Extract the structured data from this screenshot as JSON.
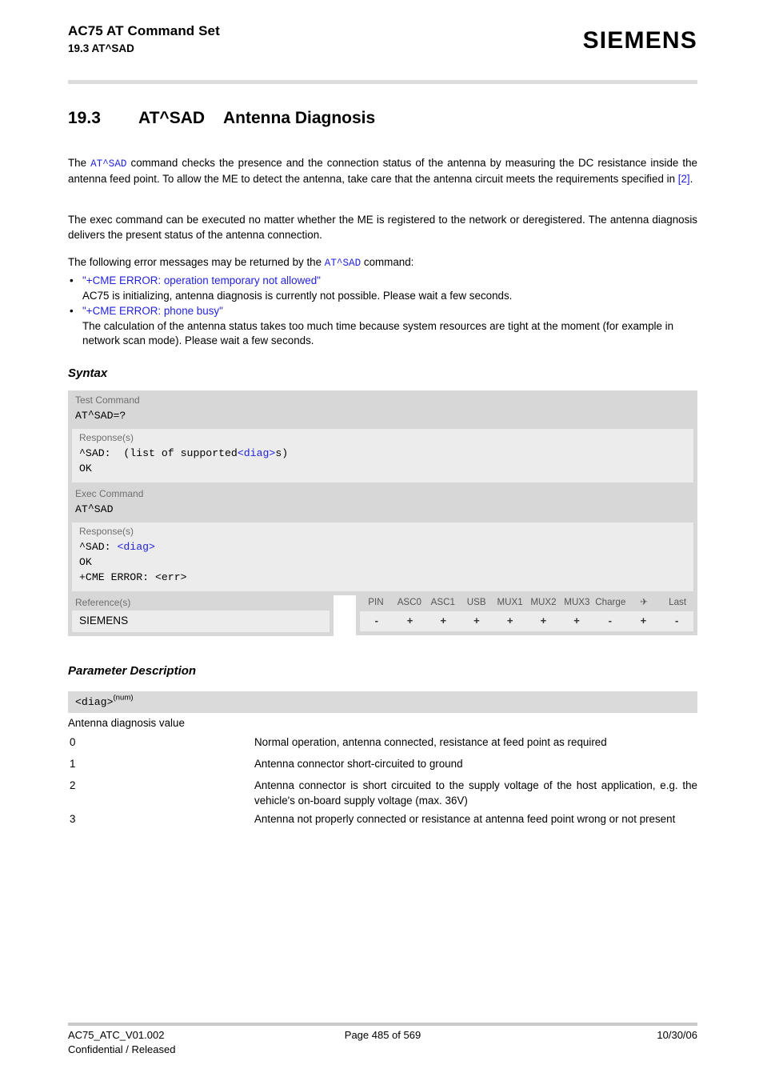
{
  "header": {
    "title": "AC75 AT Command Set",
    "subtitle": "19.3 AT^SAD",
    "logo": "SIEMENS"
  },
  "section": {
    "number": "19.3",
    "command": "AT^SAD",
    "title": "Antenna Diagnosis"
  },
  "intro": {
    "p1_a": "The ",
    "p1_cmd": "AT^SAD",
    "p1_b": " command checks the presence and the connection status of the antenna by measuring the DC resistance inside the antenna feed point. To allow the ME to detect the antenna, take care that the antenna circuit meets the requirements specified in ",
    "p1_ref": "[2]",
    "p1_c": ".",
    "p2": "The exec command can be executed no matter whether the ME is registered to the network or deregistered. The antenna diagnosis delivers the present status of the antenna connection.",
    "p3_a": "The following error messages may be returned by the ",
    "p3_cmd": "AT^SAD",
    "p3_b": " command:"
  },
  "bullets": [
    {
      "marker": "•",
      "head": "\"+CME ERROR: operation temporary not allowed\"",
      "body": "AC75 is initializing, antenna diagnosis is currently not possible. Please wait a few seconds."
    },
    {
      "marker": "•",
      "head": "\"+CME ERROR: phone busy\"",
      "body": "The calculation of the antenna status takes too much time because system resources are tight at the moment (for example in network scan mode). Please wait a few seconds."
    }
  ],
  "syntax": {
    "heading": "Syntax",
    "test": {
      "label": "Test Command",
      "code": "AT^SAD=?",
      "code_pre": "AT",
      "code_caret": "^",
      "code_post": "SAD=?",
      "response_label": "Response(s)",
      "resp_line1_a": "^SAD:  (list of supported",
      "resp_line1_b": "<diag>",
      "resp_line1_c": "s)",
      "resp_line2": "OK"
    },
    "exec": {
      "label": "Exec Command",
      "code_pre": "AT",
      "code_caret": "^",
      "code_post": "SAD",
      "response_label": "Response(s)",
      "resp_line1_a": "^SAD: ",
      "resp_line1_b": "<diag>",
      "resp_line2": "OK",
      "resp_line3": "+CME ERROR: <err>"
    },
    "reference": {
      "label": "Reference(s)",
      "value": "SIEMENS"
    },
    "capability": {
      "columns": [
        "PIN",
        "ASC0",
        "ASC1",
        "USB",
        "MUX1",
        "MUX2",
        "MUX3",
        "Charge",
        "✈",
        "Last"
      ],
      "values": [
        "-",
        "+",
        "+",
        "+",
        "+",
        "+",
        "+",
        "-",
        "+",
        "-"
      ]
    }
  },
  "parameters": {
    "heading": "Parameter Description",
    "name": "<diag>",
    "type": "(num)",
    "description": "Antenna diagnosis value",
    "rows": [
      {
        "key": "0",
        "desc": "Normal operation, antenna connected, resistance at feed point as required"
      },
      {
        "key": "1",
        "desc": "Antenna connector short-circuited to ground"
      },
      {
        "key": "2",
        "desc": "Antenna connector is short circuited to the supply voltage of the host application, e.g. the vehicle's on-board supply voltage (max. 36V)"
      },
      {
        "key": "3",
        "desc": "Antenna not properly connected or resistance at antenna feed point wrong or not present"
      }
    ]
  },
  "footer": {
    "left": "AC75_ATC_V01.002",
    "left2": "Confidential / Released",
    "center": "Page 485 of 569",
    "right": "10/30/06"
  }
}
